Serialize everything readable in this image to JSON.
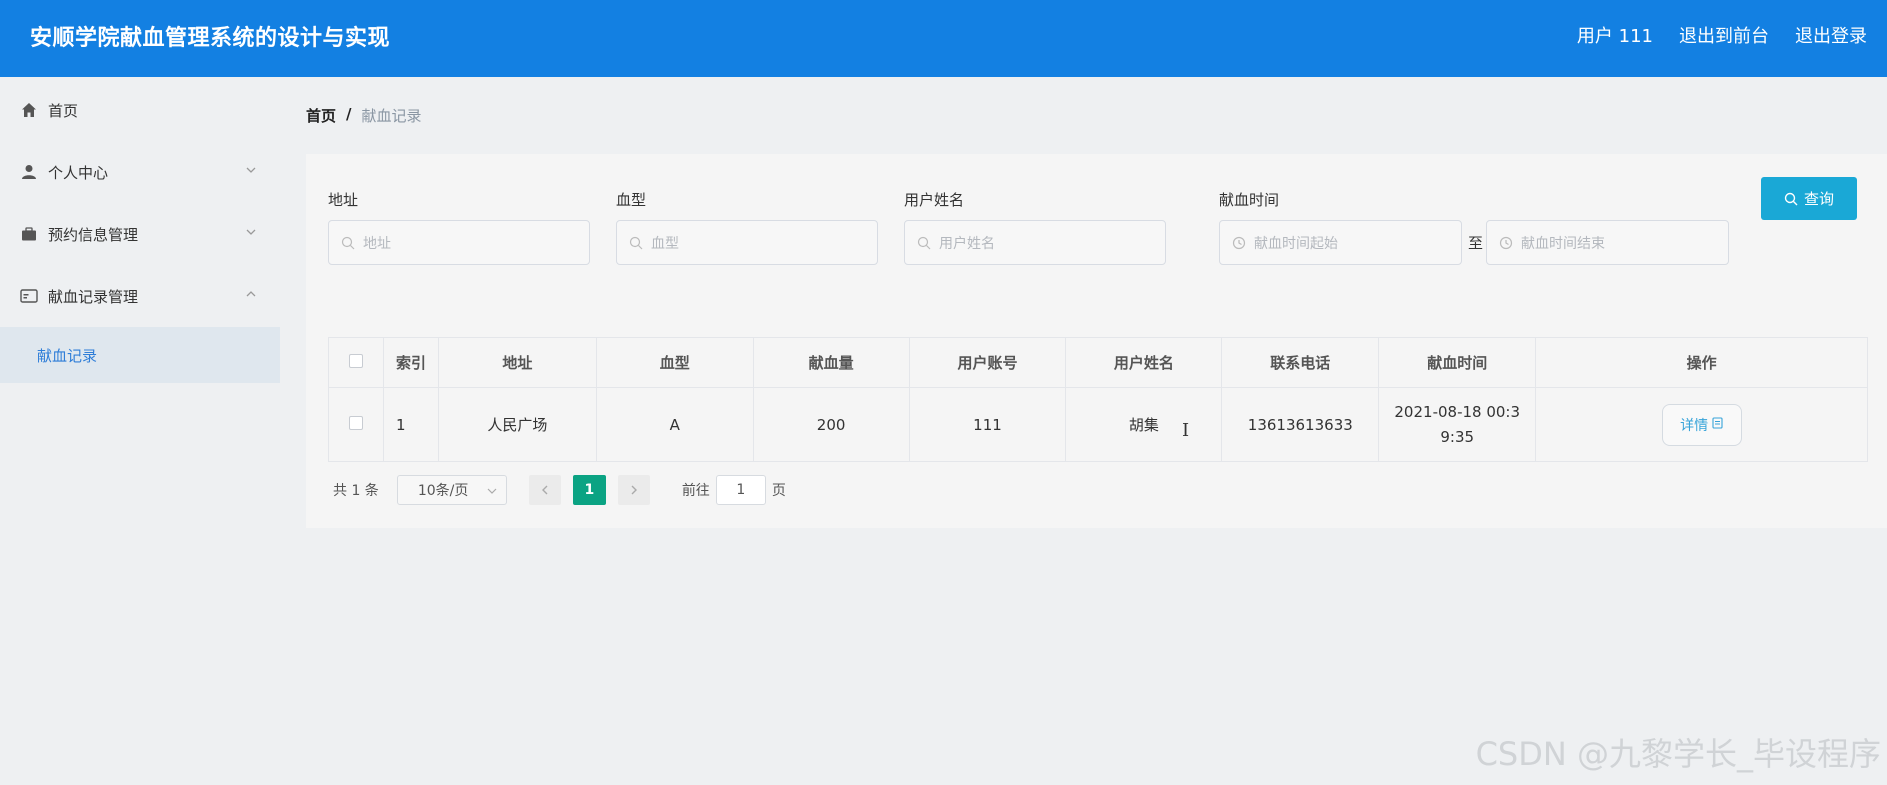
{
  "header": {
    "app_title": "安顺学院献血管理系统的设计与实现",
    "user": "用户 111",
    "exit_front": "退出到前台",
    "logout": "退出登录"
  },
  "sidebar": {
    "items": [
      {
        "label": "首页"
      },
      {
        "label": "个人中心"
      },
      {
        "label": "预约信息管理"
      },
      {
        "label": "献血记录管理"
      }
    ],
    "submenu": {
      "label": "献血记录"
    }
  },
  "breadcrumb": {
    "home": "首页",
    "sep": "/",
    "current": "献血记录"
  },
  "filters": {
    "address": {
      "label": "地址",
      "placeholder": "地址"
    },
    "blood_type": {
      "label": "血型",
      "placeholder": "血型"
    },
    "username": {
      "label": "用户姓名",
      "placeholder": "用户姓名"
    },
    "donate_time": {
      "label": "献血时间",
      "start_placeholder": "献血时间起始",
      "end_placeholder": "献血时间结束",
      "to": "至"
    },
    "search_label": "查询"
  },
  "table": {
    "headers": [
      "索引",
      "地址",
      "血型",
      "献血量",
      "用户账号",
      "用户姓名",
      "联系电话",
      "献血时间",
      "操作"
    ],
    "rows": [
      {
        "index": "1",
        "address": "人民广场",
        "blood_type": "A",
        "amount": "200",
        "account": "111",
        "name": "胡集",
        "phone": "13613613633",
        "time_line1": "2021-08-18 00:3",
        "time_line2": "9:35",
        "action": "详情"
      }
    ]
  },
  "pagination": {
    "total": "共 1 条",
    "page_size": "10条/页",
    "current_page": "1",
    "goto_label": "前往",
    "goto_value": "1",
    "page_suffix": "页"
  },
  "watermark": "CSDN @九黎学长_毕设程序",
  "colors": {
    "header_bg": "#1380e2",
    "search_button": "#1aa8d6",
    "active_page": "#0ba383",
    "submenu_text": "#2f7ed8"
  }
}
